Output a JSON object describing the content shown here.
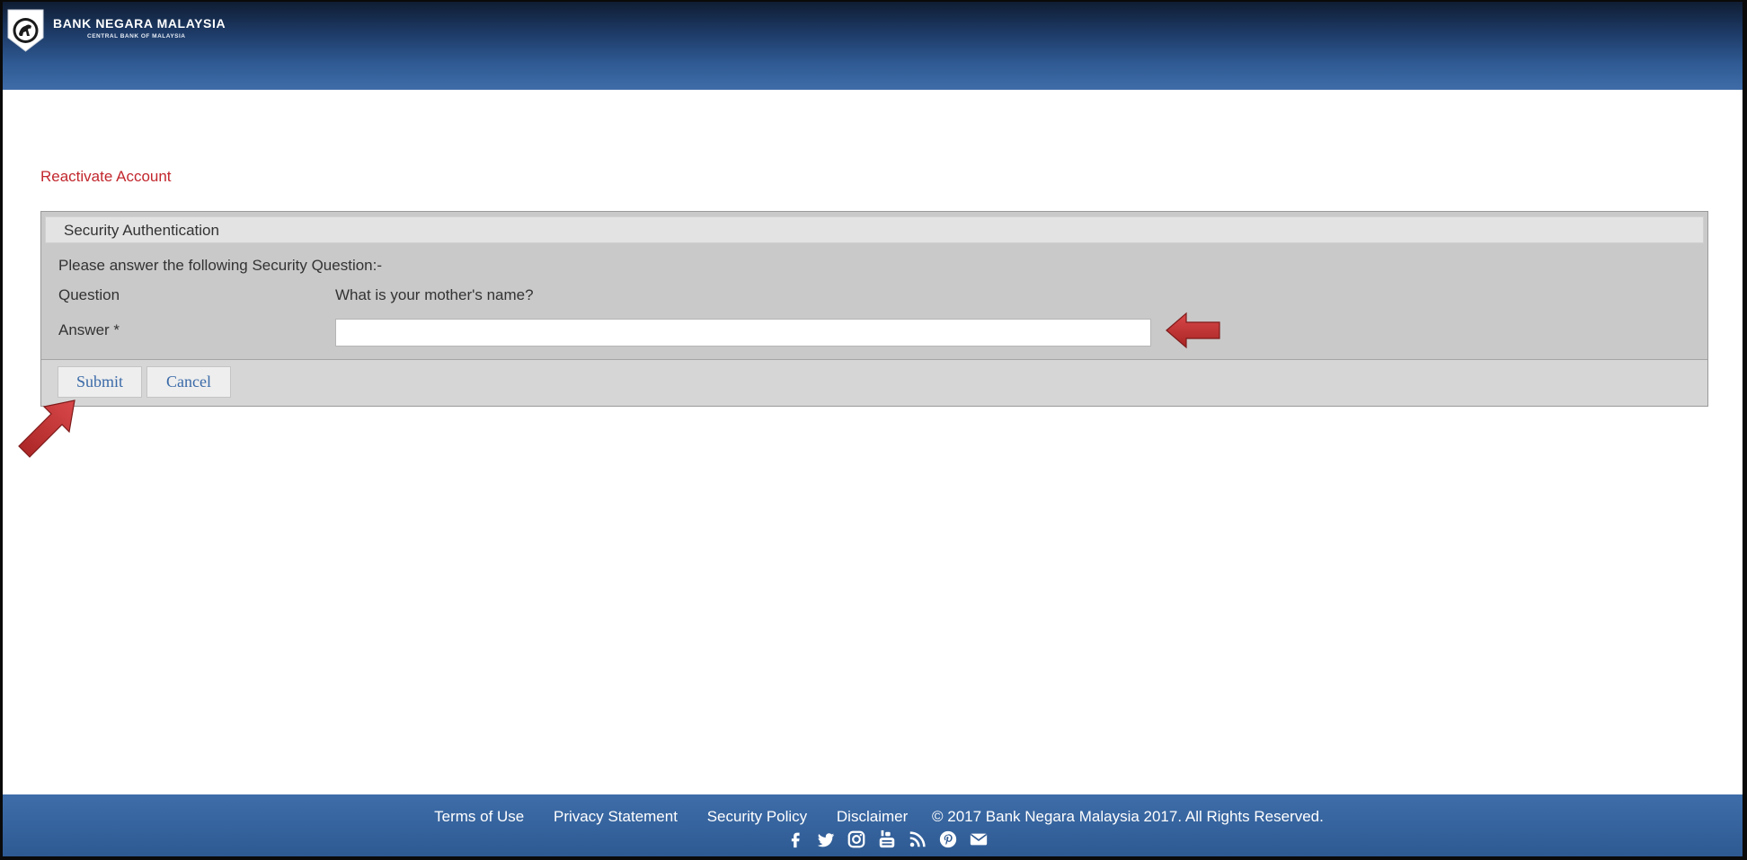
{
  "header": {
    "brand_title": "BANK NEGARA MALAYSIA",
    "brand_subtitle": "CENTRAL BANK OF MALAYSIA"
  },
  "page": {
    "title": "Reactivate Account"
  },
  "form": {
    "section_title": "Security Authentication",
    "instruction": "Please answer the following Security Question:-",
    "question_label": "Question",
    "question_value": "What is your mother's name?",
    "answer_label": "Answer *",
    "answer_value": "",
    "submit_label": "Submit",
    "cancel_label": "Cancel"
  },
  "footer": {
    "links": [
      "Terms of Use",
      "Privacy Statement",
      "Security Policy",
      "Disclaimer"
    ],
    "copyright": "© 2017 Bank Negara Malaysia 2017. All Rights Reserved.",
    "social_icons": [
      "facebook-icon",
      "twitter-icon",
      "instagram-icon",
      "youtube-icon",
      "rss-icon",
      "pinterest-icon",
      "email-icon"
    ]
  },
  "colors": {
    "header_blue": "#2f5a93",
    "title_red": "#c2272d",
    "button_text": "#3a6aa8",
    "arrow_red": "#c0302e"
  }
}
